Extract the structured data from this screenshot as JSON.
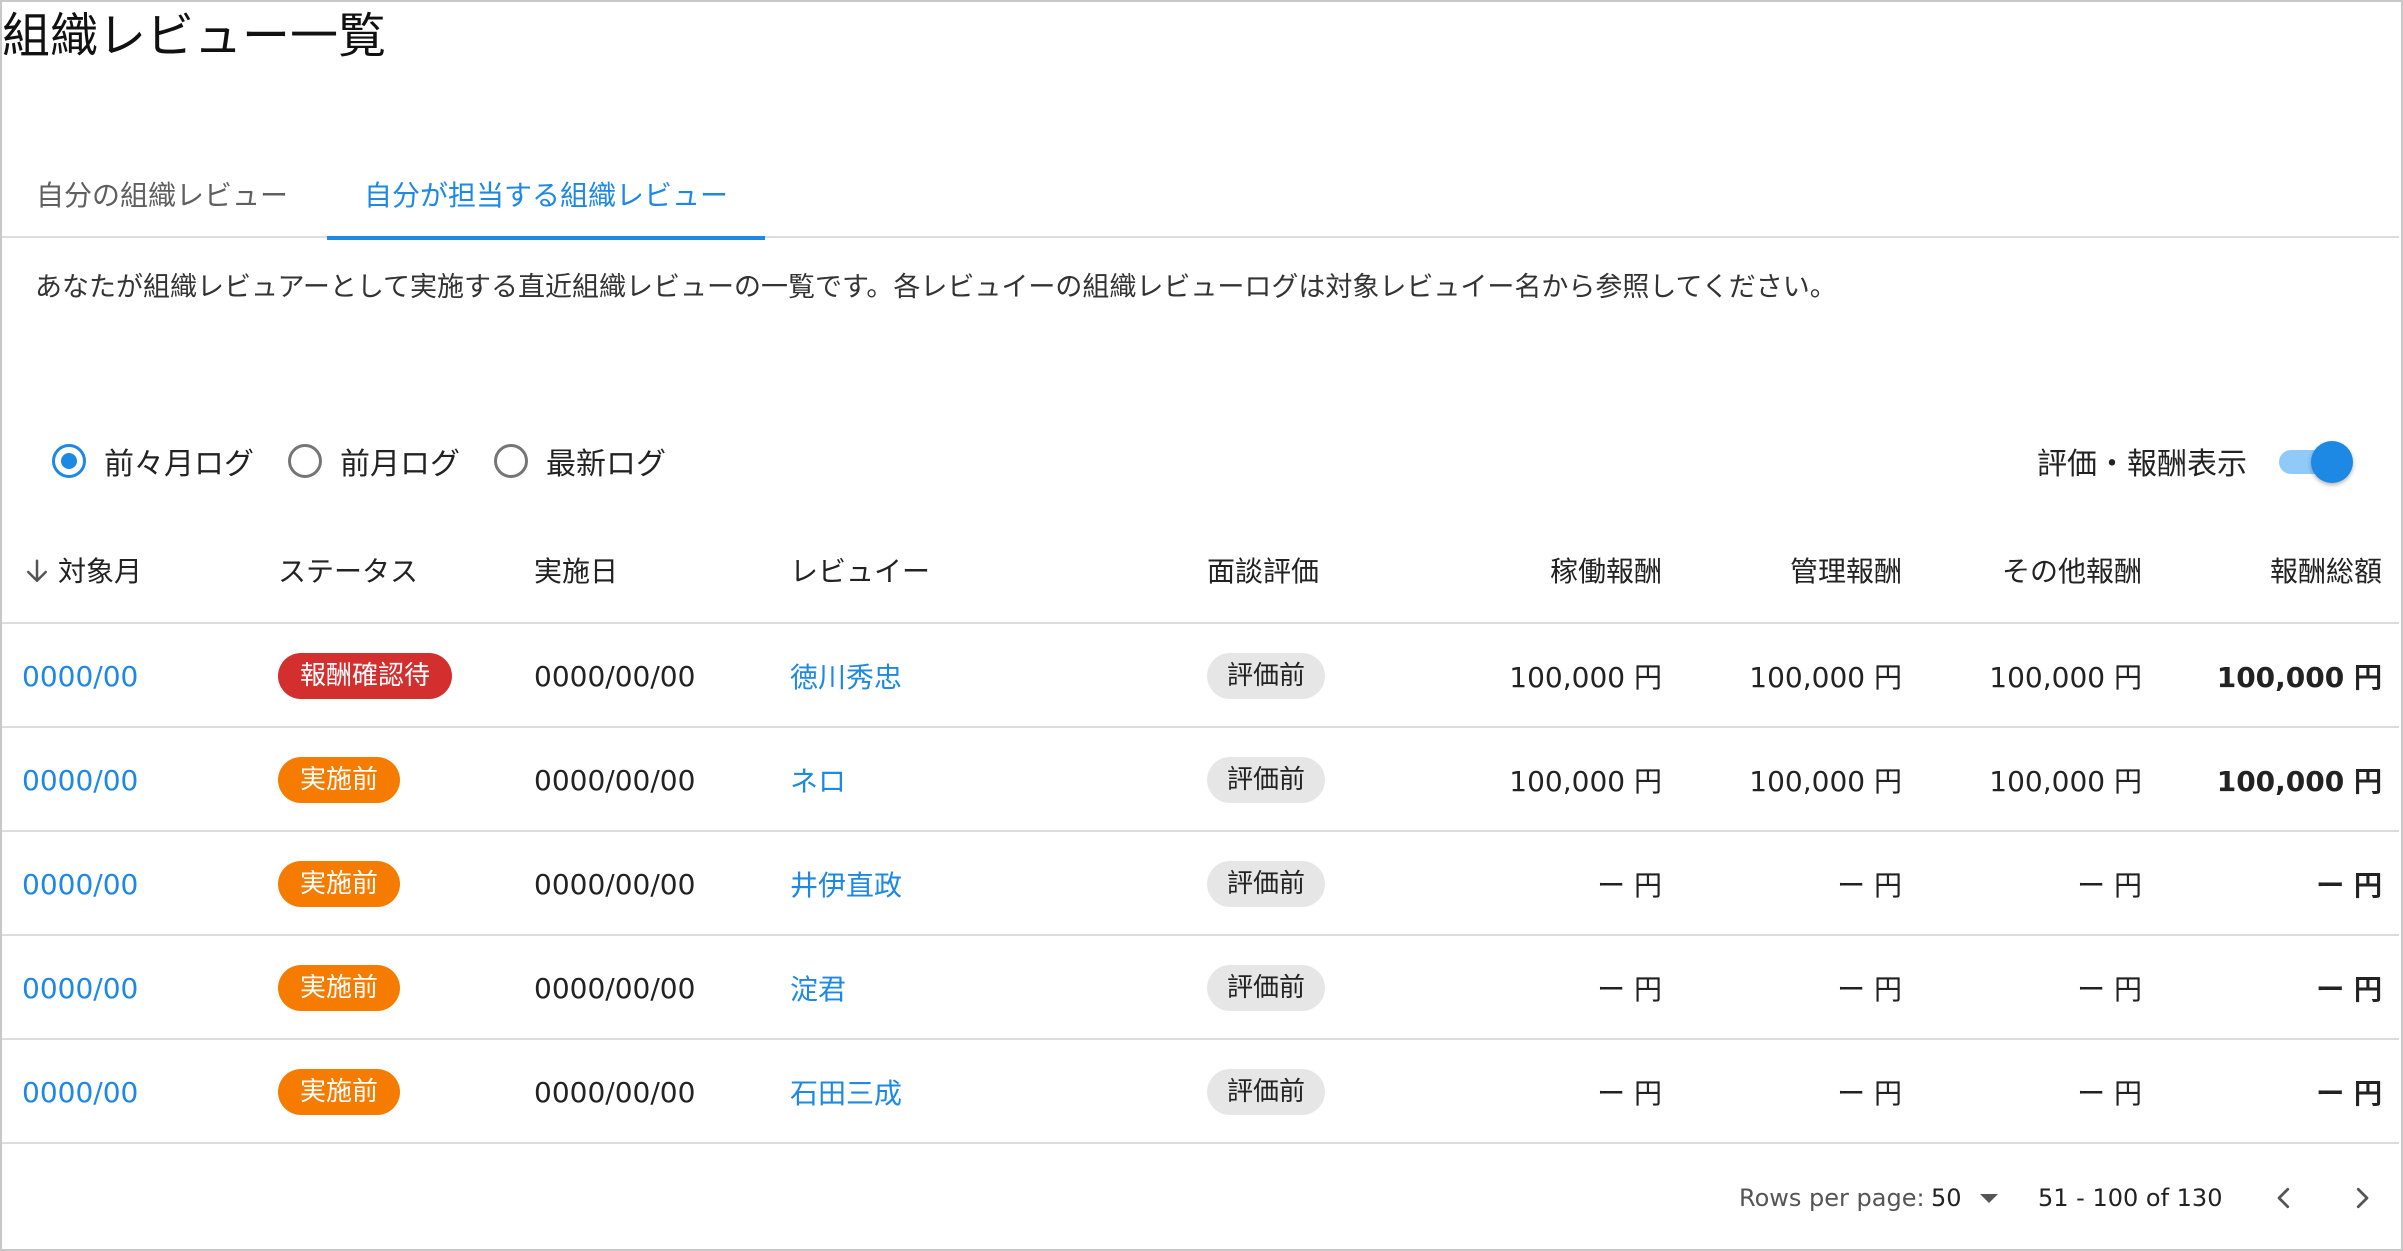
{
  "page": {
    "title": "組織レビュー一覧"
  },
  "tabs": [
    {
      "label": "自分の組織レビュー",
      "active": false
    },
    {
      "label": "自分が担当する組織レビュー",
      "active": true
    }
  ],
  "description": "あなたが組織レビュアーとして実施する直近組織レビューの一覧です。各レビュイーの組織レビューログは対象レビュイー名から参照してください。",
  "log_filter": {
    "options": [
      {
        "label": "前々月ログ",
        "checked": true
      },
      {
        "label": "前月ログ",
        "checked": false
      },
      {
        "label": "最新ログ",
        "checked": false
      }
    ]
  },
  "toggle": {
    "label": "評価・報酬表示",
    "on": true
  },
  "table": {
    "columns": {
      "month": "対象月",
      "status": "ステータス",
      "date": "実施日",
      "reviewee": "レビュイー",
      "interview": "面談評価",
      "work": "稼働報酬",
      "mgmt": "管理報酬",
      "other": "その他報酬",
      "total": "報酬総額"
    },
    "rows": [
      {
        "month": "0000/00",
        "status": "報酬確認待",
        "status_color": "#d32f2f",
        "date": "0000/00/00",
        "reviewee": "徳川秀忠",
        "interview": "評価前",
        "work": "100,000 円",
        "mgmt": "100,000 円",
        "other": "100,000 円",
        "total": "100,000 円"
      },
      {
        "month": "0000/00",
        "status": "実施前",
        "status_color": "#f57c00",
        "date": "0000/00/00",
        "reviewee": "ネロ",
        "interview": "評価前",
        "work": "100,000 円",
        "mgmt": "100,000 円",
        "other": "100,000 円",
        "total": "100,000 円"
      },
      {
        "month": "0000/00",
        "status": "実施前",
        "status_color": "#f57c00",
        "date": "0000/00/00",
        "reviewee": "井伊直政",
        "interview": "評価前",
        "work": "ー 円",
        "mgmt": "ー 円",
        "other": "ー 円",
        "total": "ー 円"
      },
      {
        "month": "0000/00",
        "status": "実施前",
        "status_color": "#f57c00",
        "date": "0000/00/00",
        "reviewee": "淀君",
        "interview": "評価前",
        "work": "ー 円",
        "mgmt": "ー 円",
        "other": "ー 円",
        "total": "ー 円"
      },
      {
        "month": "0000/00",
        "status": "実施前",
        "status_color": "#f57c00",
        "date": "0000/00/00",
        "reviewee": "石田三成",
        "interview": "評価前",
        "work": "ー 円",
        "mgmt": "ー 円",
        "other": "ー 円",
        "total": "ー 円"
      }
    ]
  },
  "pagination": {
    "rows_per_page_label": "Rows per page:",
    "rows_per_page": "50",
    "range": "51 - 100 of 130"
  },
  "colors": {
    "accent": "#1e88e5",
    "status_red": "#d32f2f",
    "status_orange": "#f57c00"
  }
}
